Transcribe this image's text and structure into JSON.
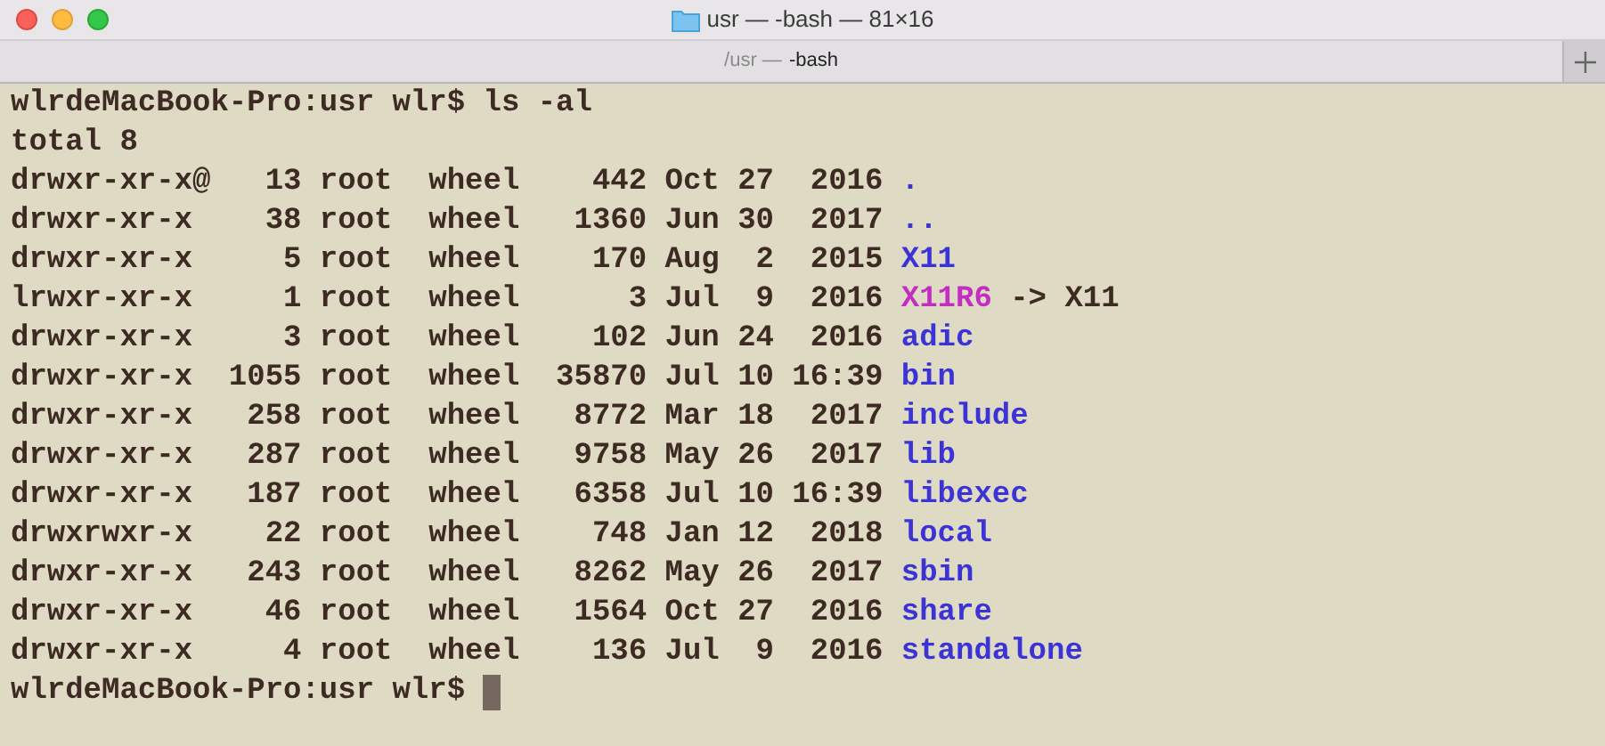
{
  "window": {
    "title": "usr — -bash — 81×16"
  },
  "tab": {
    "path": "/usr —",
    "command": "-bash",
    "selected": true
  },
  "terminal": {
    "lines": [
      {
        "kind": "prompt",
        "text": "wlrdeMacBook-Pro:usr wlr$ ls -al"
      },
      {
        "kind": "plain",
        "text": "total 8"
      },
      {
        "kind": "dir",
        "text": "drwxr-xr-x@   13 root  wheel    442 Oct 27  2016 ",
        "name": "."
      },
      {
        "kind": "dir",
        "text": "drwxr-xr-x    38 root  wheel   1360 Jun 30  2017 ",
        "name": ".."
      },
      {
        "kind": "dir",
        "text": "drwxr-xr-x     5 root  wheel    170 Aug  2  2015 ",
        "name": "X11"
      },
      {
        "kind": "symlink",
        "text": "lrwxr-xr-x     1 root  wheel      3 Jul  9  2016 ",
        "name": "X11R6",
        "target": " -> X11"
      },
      {
        "kind": "dir",
        "text": "drwxr-xr-x     3 root  wheel    102 Jun 24  2016 ",
        "name": "adic"
      },
      {
        "kind": "dir",
        "text": "drwxr-xr-x  1055 root  wheel  35870 Jul 10 16:39 ",
        "name": "bin"
      },
      {
        "kind": "dir",
        "text": "drwxr-xr-x   258 root  wheel   8772 Mar 18  2017 ",
        "name": "include"
      },
      {
        "kind": "dir",
        "text": "drwxr-xr-x   287 root  wheel   9758 May 26  2017 ",
        "name": "lib"
      },
      {
        "kind": "dir",
        "text": "drwxr-xr-x   187 root  wheel   6358 Jul 10 16:39 ",
        "name": "libexec"
      },
      {
        "kind": "dir",
        "text": "drwxrwxr-x    22 root  wheel    748 Jan 12  2018 ",
        "name": "local"
      },
      {
        "kind": "dir",
        "text": "drwxr-xr-x   243 root  wheel   8262 May 26  2017 ",
        "name": "sbin"
      },
      {
        "kind": "dir",
        "text": "drwxr-xr-x    46 root  wheel   1564 Oct 27  2016 ",
        "name": "share"
      },
      {
        "kind": "dir",
        "text": "drwxr-xr-x     4 root  wheel    136 Jul  9  2016 ",
        "name": "standalone"
      }
    ],
    "prompt": "wlrdeMacBook-Pro:usr wlr$ "
  }
}
